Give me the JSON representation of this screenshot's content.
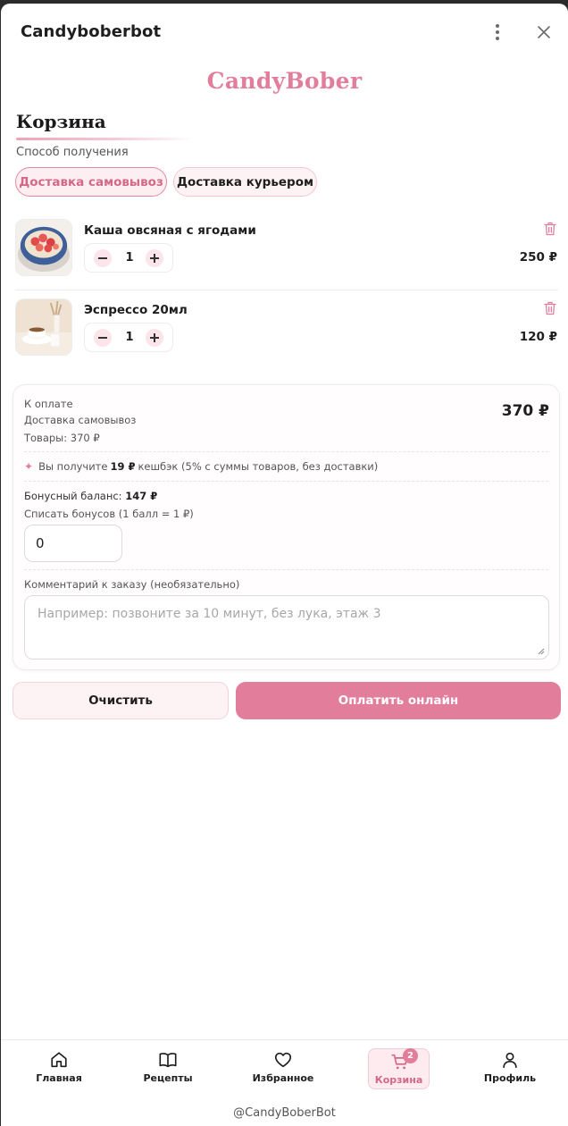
{
  "window": {
    "title": "Candyboberbot"
  },
  "brand": {
    "name": "CandyBober"
  },
  "cart": {
    "title": "Корзина",
    "delivery_label": "Способ получения",
    "delivery_options": [
      "Доставка самовывоз",
      "Доставка курьером"
    ],
    "selected_option": "Доставка самовывоз",
    "items": [
      {
        "name": "Каша овсяная с ягодами",
        "qty": "1",
        "price": "250 ₽"
      },
      {
        "name": "Эспрессо 20мл",
        "qty": "1",
        "price": "120 ₽"
      }
    ]
  },
  "summary": {
    "to_pay_label": "К оплате",
    "delivery_text": "Доставка самовывоз",
    "goods_text": "Товары: 370 ₽",
    "total": "370 ₽",
    "cashback_prefix": "Вы получите",
    "cashback_amount": "19 ₽",
    "cashback_suffix": "кешбэк (5% с суммы товаров, без доставки)",
    "bonus_label": "Бонусный баланс:",
    "bonus_value": "147 ₽",
    "bonus_write_off_label": "Списать бонусов (1 балл = 1 ₽)",
    "bonus_input_value": "0",
    "comment_label": "Комментарий к заказу (необязательно)",
    "comment_placeholder": "Например: позвоните за 10 минут, без лука, этаж 3"
  },
  "actions": {
    "clear": "Очистить",
    "pay": "Оплатить онлайн"
  },
  "nav": {
    "items": [
      {
        "label": "Главная",
        "icon": "home-icon"
      },
      {
        "label": "Рецепты",
        "icon": "book-icon"
      },
      {
        "label": "Избранное",
        "icon": "heart-icon"
      },
      {
        "label": "Корзина",
        "icon": "cart-icon",
        "badge": "2",
        "active": true
      },
      {
        "label": "Профиль",
        "icon": "user-icon"
      }
    ]
  },
  "footer": {
    "handle": "@CandyBoberBot"
  },
  "colors": {
    "accent": "#e27d9c",
    "accent_light": "#fdeef2",
    "text": "#1e1e1e"
  }
}
